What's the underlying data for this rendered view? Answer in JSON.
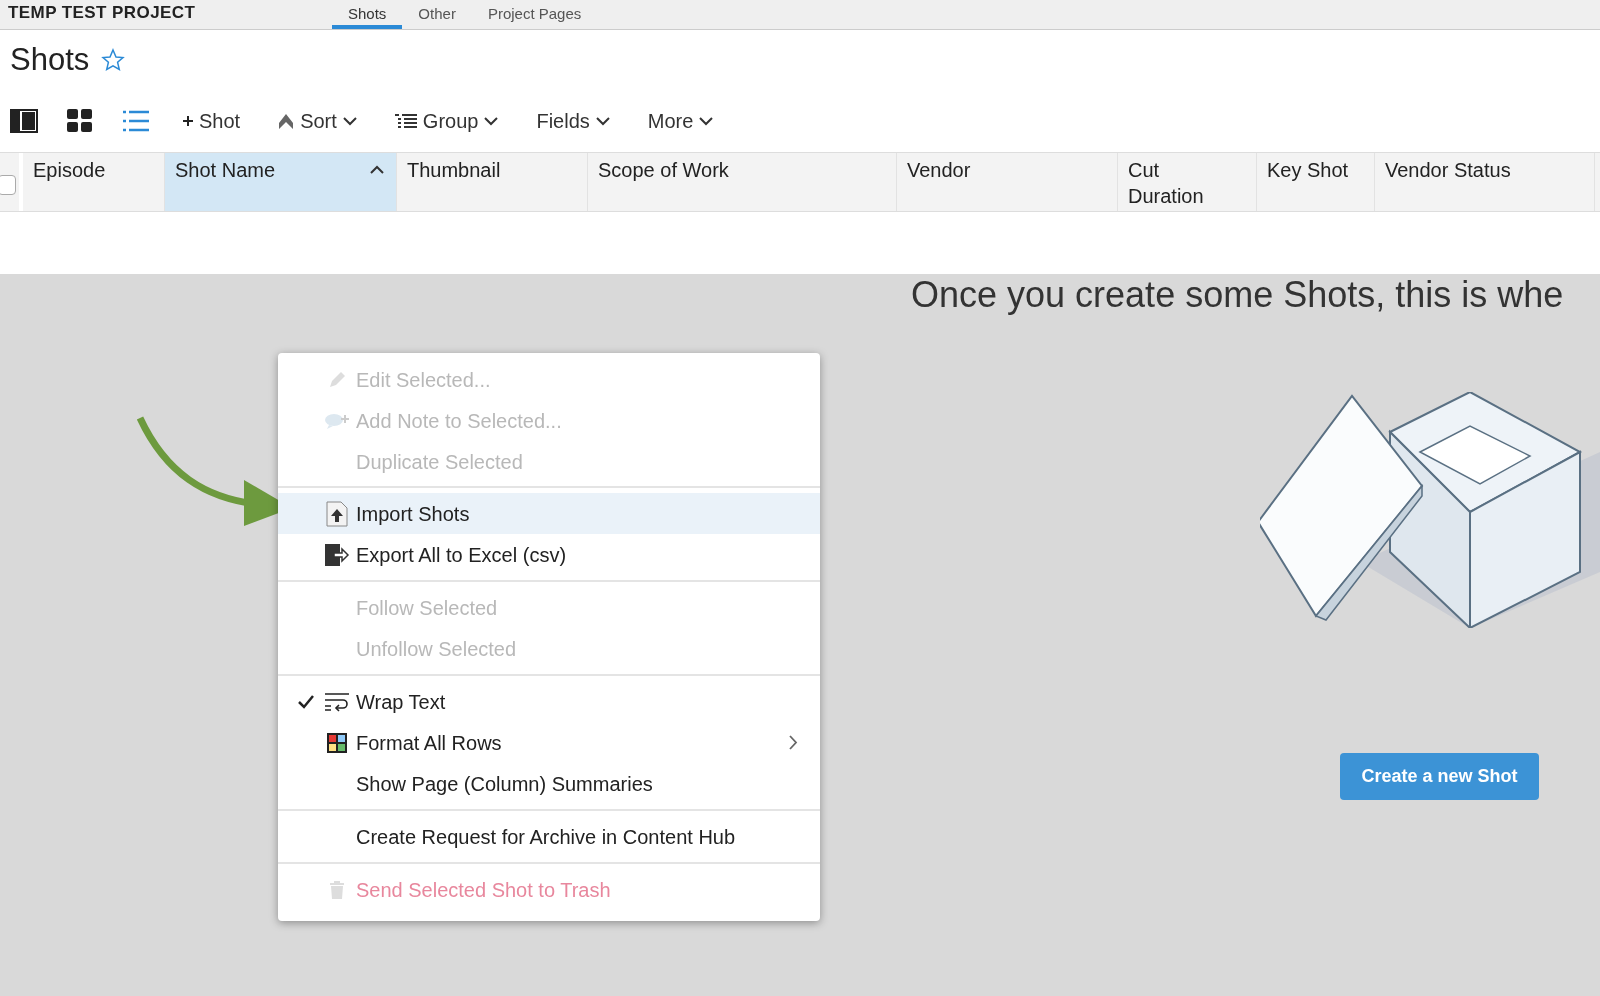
{
  "project": {
    "title": "TEMP TEST PROJECT"
  },
  "nav_tabs": [
    {
      "label": "Shots",
      "selected": true
    },
    {
      "label": "Other",
      "selected": false
    },
    {
      "label": "Project Pages",
      "selected": false
    }
  ],
  "page": {
    "title": "Shots",
    "favorite": false
  },
  "toolbar": {
    "views": [
      {
        "selected": false
      },
      {
        "selected": false
      },
      {
        "selected": true
      }
    ],
    "buttons": [
      {
        "label": "Shot",
        "kind": "add"
      },
      {
        "label": "Sort",
        "kind": "sort"
      },
      {
        "label": "Group",
        "kind": "group"
      },
      {
        "label": "Fields",
        "kind": "plain"
      },
      {
        "label": "More",
        "kind": "plain"
      }
    ]
  },
  "table": {
    "select_all": {
      "checked": false
    },
    "columns": [
      {
        "label": "Episode",
        "selected": false
      },
      {
        "label": "Shot Name",
        "selected": true
      },
      {
        "label": "Thumbnail",
        "selected": false
      },
      {
        "label": "Scope of Work",
        "selected": false
      },
      {
        "label": "Vendor",
        "selected": false
      },
      {
        "label": "Cut Duration",
        "selected": false
      },
      {
        "label": "Key Shot",
        "selected": false
      },
      {
        "label": "Vendor Status",
        "selected": false
      }
    ]
  },
  "empty_state": {
    "message": "Once you create some Shots, this is whe",
    "button": "Create a new Shot"
  },
  "context_menu": {
    "groups": [
      [
        {
          "label": "Edit Selected...",
          "disabled": true,
          "selected": false,
          "checked": false,
          "submenu": false
        },
        {
          "label": "Add Note to Selected...",
          "disabled": true,
          "selected": false,
          "checked": false,
          "submenu": false
        },
        {
          "label": "Duplicate Selected",
          "disabled": true,
          "selected": false,
          "checked": false,
          "submenu": false
        }
      ],
      [
        {
          "label": "Import Shots",
          "disabled": false,
          "selected": true,
          "checked": false,
          "submenu": false
        },
        {
          "label": "Export All to Excel (csv)",
          "disabled": false,
          "selected": false,
          "checked": false,
          "submenu": false
        }
      ],
      [
        {
          "label": "Follow Selected",
          "disabled": true,
          "selected": false,
          "checked": false,
          "submenu": false
        },
        {
          "label": "Unfollow Selected",
          "disabled": true,
          "selected": false,
          "checked": false,
          "submenu": false
        }
      ],
      [
        {
          "label": "Wrap Text",
          "disabled": false,
          "selected": false,
          "checked": true,
          "submenu": false
        },
        {
          "label": "Format All Rows",
          "disabled": false,
          "selected": false,
          "checked": false,
          "submenu": true
        },
        {
          "label": "Show Page (Column) Summaries",
          "disabled": false,
          "selected": false,
          "checked": false,
          "submenu": false
        }
      ],
      [
        {
          "label": "Create Request for Archive in Content Hub",
          "disabled": false,
          "selected": false,
          "checked": false,
          "submenu": false
        }
      ],
      [
        {
          "label": "Send Selected Shot to Trash",
          "disabled": true,
          "selected": false,
          "checked": false,
          "submenu": false,
          "kind": "danger"
        }
      ]
    ]
  }
}
